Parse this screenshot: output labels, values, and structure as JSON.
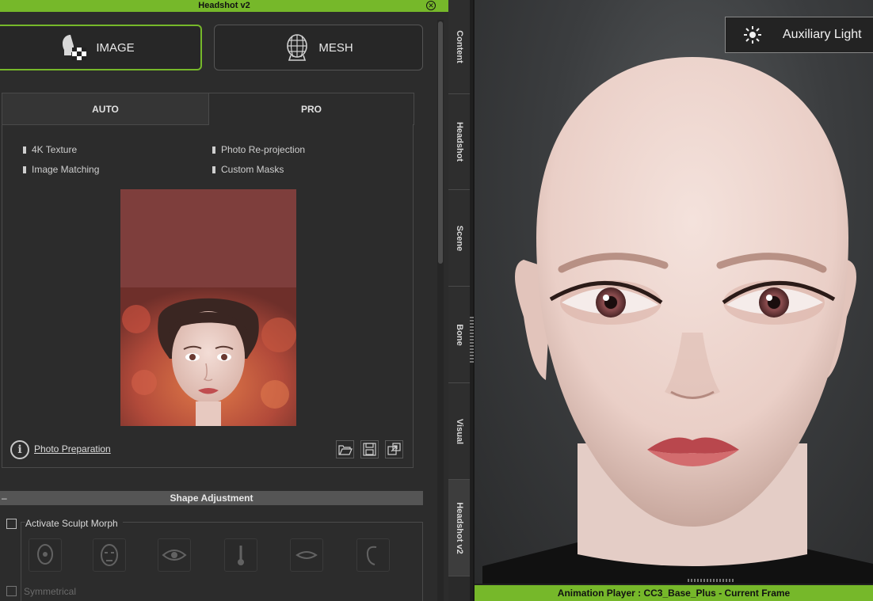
{
  "panel": {
    "title": "Headshot v2",
    "close_icon": "close-circle-icon",
    "mode_buttons": {
      "image": "IMAGE",
      "mesh": "MESH"
    },
    "tabs": {
      "auto": "AUTO",
      "pro": "PRO"
    },
    "features": [
      "4K Texture",
      "Photo Re-projection",
      "Image Matching",
      "Custom Masks"
    ],
    "photo_prep_label": "Photo Preparation",
    "tool_icons": [
      "folder-open-icon",
      "save-icon",
      "export-icon"
    ],
    "shape_section": "Shape Adjustment",
    "activate_sculpt": "Activate Sculpt Morph",
    "symmetrical": "Symmetrical",
    "morph_icons": [
      "head-morph-icon",
      "face-morph-icon",
      "eye-morph-icon",
      "nose-morph-icon",
      "mouth-morph-icon",
      "ear-morph-icon"
    ]
  },
  "side_tabs": [
    "Content",
    "Headshot",
    "Scene",
    "Bone",
    "Visual",
    "Headshot v2"
  ],
  "viewport": {
    "aux_light_label": "Auxiliary Light",
    "status_bar": "Animation Player : CC3_Base_Plus - Current Frame"
  },
  "colors": {
    "accent": "#76b82a",
    "panel_bg": "#2c2c2c",
    "photo_bg": "#7e3e3c"
  }
}
